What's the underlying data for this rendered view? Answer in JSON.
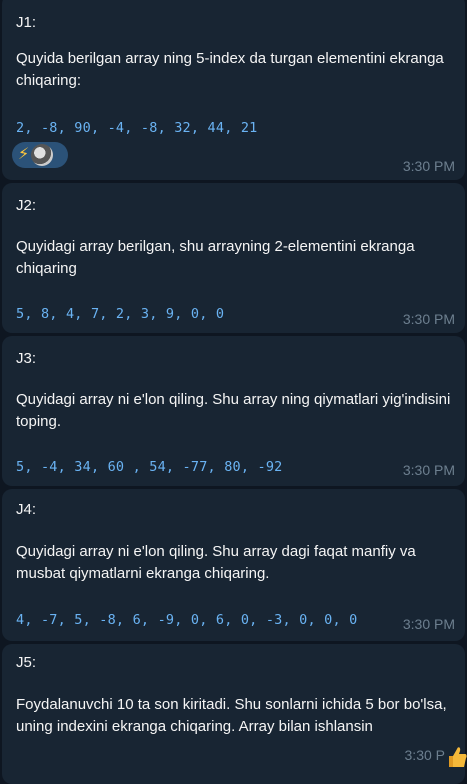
{
  "messages": [
    {
      "title": "J1:",
      "text": "Quyida berilgan array ning 5-index da turgan elementini ekranga chiqaring:",
      "code": "2, -8, 90, -4, -8, 32, 44, 21",
      "time": "3:30 PM",
      "reactions": [
        "lightning-emoji",
        "user-avatar"
      ]
    },
    {
      "title": "J2:",
      "text": "Quyidagi array berilgan, shu arrayning 2-elementini ekranga chiqaring",
      "code": "5, 8, 4, 7, 2, 3, 9, 0, 0",
      "time": "3:30 PM"
    },
    {
      "title": "J3:",
      "text": "Quyidagi array ni e'lon qiling. Shu array ning qiymatlari yig'indisini toping.",
      "code": "5, -4, 34, 60 , 54, -77, 80, -92",
      "time": "3:30 PM"
    },
    {
      "title": "J4:",
      "text": "Quyidagi array ni e'lon qiling. Shu array dagi faqat manfiy va musbat qiymatlarni ekranga chiqaring.",
      "code": "4, -7, 5, -8, 6, -9, 0, 6, 0, -3, 0, 0, 0",
      "time": "3:30 PM"
    },
    {
      "title": "J5:",
      "text": "Foydalanuvchi 10 ta son kiritadi. Shu sonlarni ichida 5 bor bo'lsa, uning indexini ekranga chiqaring. Array bilan ishlansin",
      "time": "3:30 P"
    }
  ],
  "colors": {
    "background": "#0e1621",
    "bubble": "#182533",
    "code": "#6ab3f3",
    "time": "#6d7f8f",
    "reaction_pill": "#2b5278"
  }
}
